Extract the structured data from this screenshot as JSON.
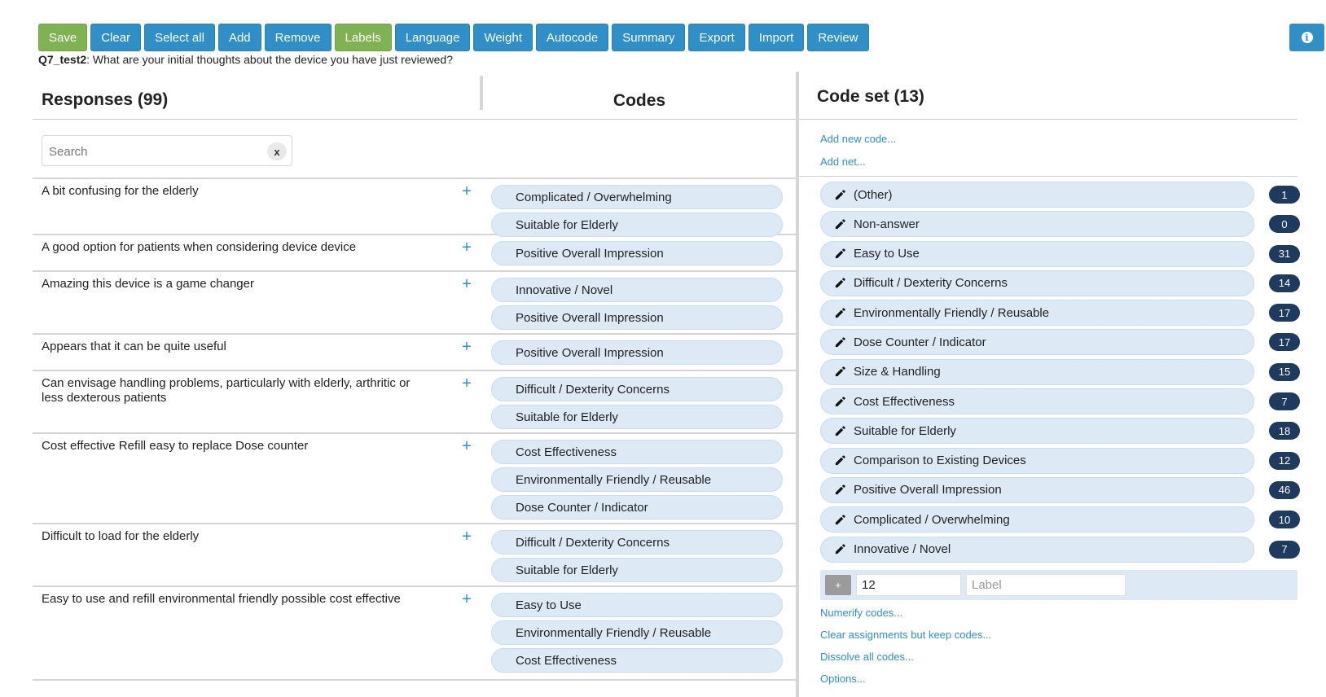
{
  "toolbar": {
    "buttons": [
      {
        "label": "Save",
        "style": "green"
      },
      {
        "label": "Clear",
        "style": "blue"
      },
      {
        "label": "Select all",
        "style": "blue"
      },
      {
        "label": "Add",
        "style": "blue"
      },
      {
        "label": "Remove",
        "style": "blue"
      },
      {
        "label": "Labels",
        "style": "green"
      },
      {
        "label": "Language",
        "style": "blue"
      },
      {
        "label": "Weight",
        "style": "blue"
      },
      {
        "label": "Autocode",
        "style": "blue"
      },
      {
        "label": "Summary",
        "style": "blue"
      },
      {
        "label": "Export",
        "style": "blue"
      },
      {
        "label": "Import",
        "style": "blue"
      },
      {
        "label": "Review",
        "style": "blue"
      }
    ],
    "info_icon": "info-circle-icon"
  },
  "question": {
    "id": "Q7_test2",
    "text": ": What are your initial thoughts about the device you have just reviewed?"
  },
  "responses": {
    "title": "Responses (99)",
    "codes_header": "Codes",
    "search": {
      "placeholder": "Search",
      "value": "",
      "clear_label": "x"
    },
    "rows": [
      {
        "text": "A bit confusing for the elderly",
        "codes": [
          "Complicated / Overwhelming",
          "Suitable for Elderly"
        ]
      },
      {
        "text": "A good option for patients when considering device device",
        "codes": [
          "Positive Overall Impression"
        ]
      },
      {
        "text": "Amazing this device is a game changer",
        "codes": [
          "Innovative / Novel",
          "Positive Overall Impression"
        ]
      },
      {
        "text": "Appears that it can be quite useful",
        "codes": [
          "Positive Overall Impression"
        ]
      },
      {
        "text": "Can envisage handling problems, particularly with elderly, arthritic or less dexterous patients",
        "codes": [
          "Difficult / Dexterity Concerns",
          "Suitable for Elderly"
        ]
      },
      {
        "text": "Cost effective Refill easy to replace Dose counter",
        "codes": [
          "Cost Effectiveness",
          "Environmentally Friendly / Reusable",
          "Dose Counter / Indicator"
        ]
      },
      {
        "text": "Difficult to load for the elderly",
        "codes": [
          "Difficult / Dexterity Concerns",
          "Suitable for Elderly"
        ]
      },
      {
        "text": "Easy to use and refill environmental friendly possible cost effective",
        "codes": [
          "Easy to Use",
          "Environmentally Friendly / Reusable",
          "Cost Effectiveness"
        ]
      }
    ]
  },
  "codeset": {
    "title": "Code set (13)",
    "add_new_code": "Add new code...",
    "add_net": "Add net...",
    "items": [
      {
        "label": "(Other)",
        "count": "1"
      },
      {
        "label": "Non-answer",
        "count": "0"
      },
      {
        "label": "Easy to Use",
        "count": "31"
      },
      {
        "label": "Difficult / Dexterity Concerns",
        "count": "14"
      },
      {
        "label": "Environmentally Friendly / Reusable",
        "count": "17"
      },
      {
        "label": "Dose Counter / Indicator",
        "count": "17"
      },
      {
        "label": "Size & Handling",
        "count": "15"
      },
      {
        "label": "Cost Effectiveness",
        "count": "7"
      },
      {
        "label": "Suitable for Elderly",
        "count": "18"
      },
      {
        "label": "Comparison to Existing Devices",
        "count": "12"
      },
      {
        "label": "Positive Overall Impression",
        "count": "46"
      },
      {
        "label": "Complicated / Overwhelming",
        "count": "10"
      },
      {
        "label": "Innovative / Novel",
        "count": "7"
      }
    ],
    "new_code": {
      "plus_label": "+",
      "number_value": "12",
      "label_placeholder": "Label"
    },
    "links": [
      "Numerify codes...",
      "Clear assignments but keep codes...",
      "Dissolve all codes...",
      "Options..."
    ]
  },
  "colors": {
    "primary": "#2f8fc6",
    "success": "#80b253",
    "pill_bg": "#dde9f5",
    "badge_bg": "#1f3a5f"
  }
}
